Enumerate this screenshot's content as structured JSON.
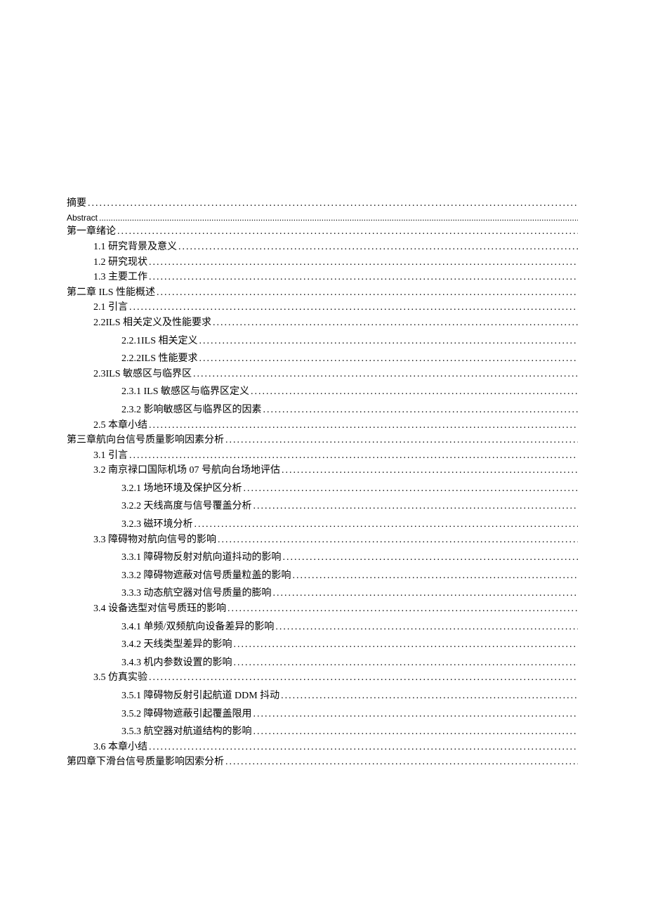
{
  "toc": [
    {
      "indent": 0,
      "label": "摘要",
      "cls": ""
    },
    {
      "indent": 0,
      "label": "Abstract",
      "cls": "abstract-line",
      "dotcls": "abstract-dots"
    },
    {
      "indent": 0,
      "label": "第一章绪论",
      "cls": ""
    },
    {
      "indent": 1,
      "label": "1.1  研究背景及意义",
      "cls": ""
    },
    {
      "indent": 1,
      "label": "1.2  研究现状",
      "cls": ""
    },
    {
      "indent": 1,
      "label": "1.3  主要工作",
      "cls": ""
    },
    {
      "indent": 0,
      "label": "第二章 ILS 性能概述",
      "cls": ""
    },
    {
      "indent": 1,
      "label": "2.1 引言",
      "cls": ""
    },
    {
      "indent": 1,
      "label": "2.2ILS 相关定义及性能要求",
      "cls": ""
    },
    {
      "indent": 2,
      "label": "2.2.1ILS 相关定义",
      "cls": "gap-med"
    },
    {
      "indent": 2,
      "label": "2.2.2ILS 性能要求",
      "cls": "gap-med"
    },
    {
      "indent": 1,
      "label": "2.3ILS 敏感区与临界区",
      "cls": ""
    },
    {
      "indent": 2,
      "label": "2.3.1  ILS 敏感区与临界区定义",
      "cls": "gap-med"
    },
    {
      "indent": 2,
      "label": "2.3.2  影响敏感区与临界区的因素",
      "cls": "gap-med"
    },
    {
      "indent": 1,
      "label": "2.5 本章小结",
      "cls": ""
    },
    {
      "indent": 0,
      "label": "第三章航向台信号质量影响因素分析",
      "cls": ""
    },
    {
      "indent": 1,
      "label": "3.1    引言",
      "cls": ""
    },
    {
      "indent": 1,
      "label": "3.2    南京禄口国际机场 07 号航向台场地评估",
      "cls": ""
    },
    {
      "indent": 2,
      "label": "3.2.1  场地环境及保护区分析",
      "cls": "gap-med"
    },
    {
      "indent": 2,
      "label": "3.2.2    天线高度与信号覆盖分析",
      "cls": "gap-med"
    },
    {
      "indent": 2,
      "label": "3.2.3      磁环境分析",
      "cls": "gap-med"
    },
    {
      "indent": 1,
      "label": "3.3    障碍物对航向信号的影响",
      "cls": ""
    },
    {
      "indent": 2,
      "label": "3.3.1  障碍物反射对航向道抖动的影响",
      "cls": "gap-med"
    },
    {
      "indent": 2,
      "label": "3.3.2  障碍物遮蔽对信号质量粒盖的影响",
      "cls": "gap-med"
    },
    {
      "indent": 2,
      "label": "3.3.3  动态航空器对信号质量的膨响",
      "cls": "gap-med"
    },
    {
      "indent": 1,
      "label": "3.4    设备选型对信号质珏的影响",
      "cls": ""
    },
    {
      "indent": 2,
      "label": "3.4.1  单频/双频航向设备差异的影响",
      "cls": "gap-med"
    },
    {
      "indent": 2,
      "label": "3.4.2  天线类型差异的影响",
      "cls": "gap-med"
    },
    {
      "indent": 2,
      "label": "3.4.3  机内参数设置的影响",
      "cls": "gap-med"
    },
    {
      "indent": 1,
      "label": "3.5    仿真实验",
      "cls": ""
    },
    {
      "indent": 2,
      "label": "3.5.1  障碍物反射引起航道 DDM 抖动",
      "cls": "gap-med"
    },
    {
      "indent": 2,
      "label": "3.5.2  障碍物遮蔽引起覆盖限用",
      "cls": "gap-med"
    },
    {
      "indent": 2,
      "label": "3.5.3  航空器对航道结构的影响",
      "cls": "gap-med"
    },
    {
      "indent": 1,
      "label": "3.6    本章小结",
      "cls": ""
    },
    {
      "indent": 0,
      "label": "第四章下滑台信号质量影响因索分析",
      "cls": ""
    }
  ]
}
